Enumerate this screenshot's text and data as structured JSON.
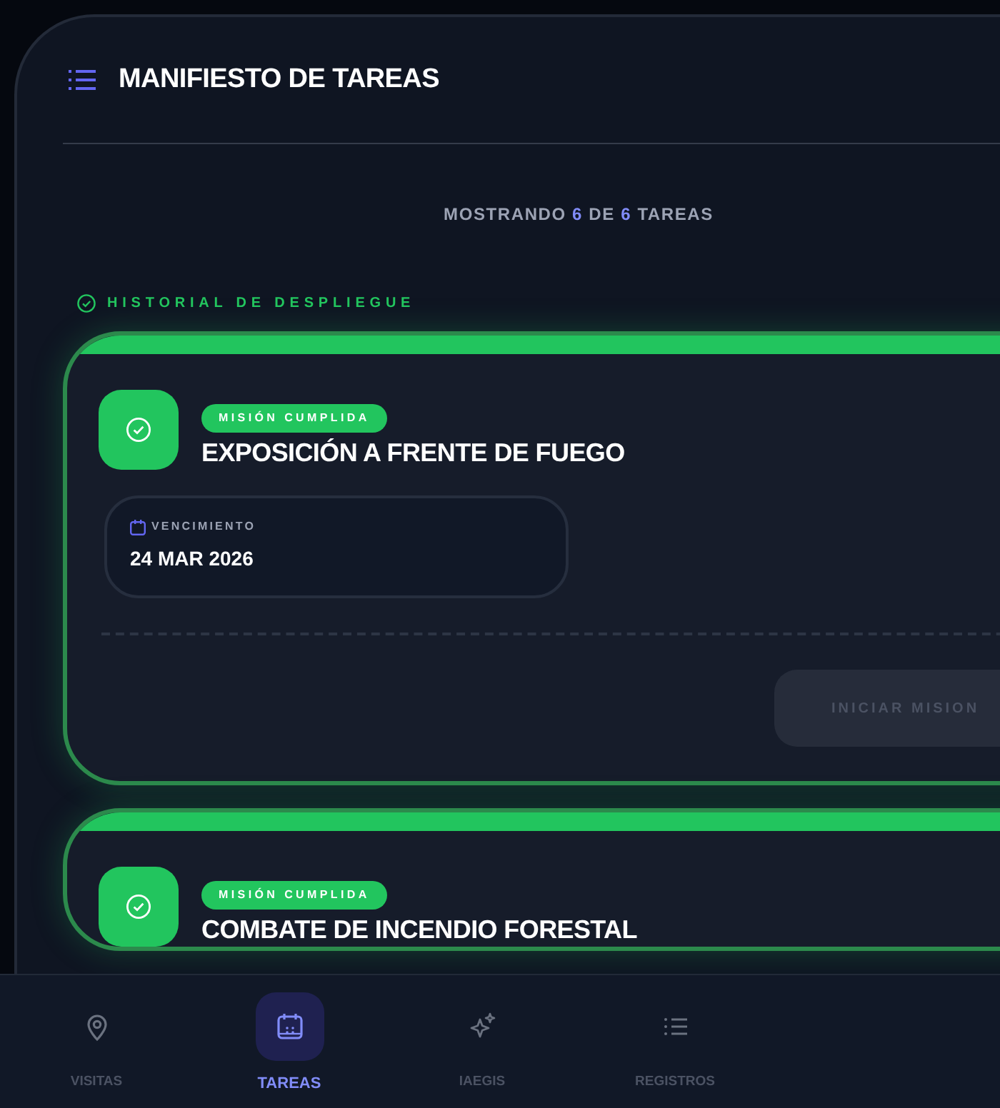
{
  "header": {
    "title": "MANIFIESTO DE TAREAS"
  },
  "summary": "MOSTRANDO **6** DE **6** TAREAS",
  "section": {
    "title": "HISTORIAL DE DESPLIEGUE"
  },
  "tasks": [
    {
      "status": "MISIÓN CUMPLIDA",
      "completed": true,
      "title": "EXPOSICIÓN A FRENTE DE FUEGO",
      "due_label": "VENCIMIENTO",
      "due_date": "24 MAR 2026",
      "action": "INICIAR MISION",
      "action_disabled": true
    },
    {
      "status": "MISIÓN CUMPLIDA",
      "completed": true,
      "title": "COMBATE DE INCENDIO FORESTAL"
    }
  ],
  "nav": [
    {
      "label": "VISITAS",
      "selected": false
    },
    {
      "label": "TAREAS",
      "selected": true
    },
    {
      "label": "IAEGIS",
      "selected": false
    },
    {
      "label": "REGISTROS",
      "selected": false
    }
  ]
}
